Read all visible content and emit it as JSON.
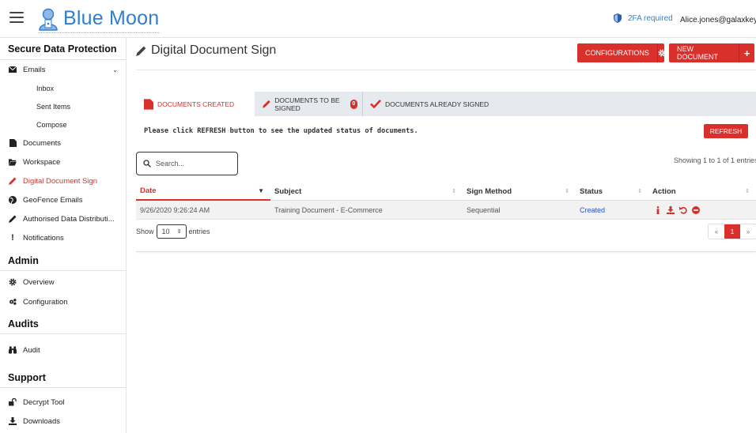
{
  "header": {
    "logo_text": "Blue Moon",
    "twofa_label": "2FA required",
    "user_email": "Alice.jones@galaxkey.io"
  },
  "sidebar": {
    "sections": [
      {
        "title": "Secure Data Protection"
      },
      {
        "title": "Admin"
      },
      {
        "title": "Audits"
      },
      {
        "title": "Support"
      }
    ],
    "emails_label": "Emails",
    "email_subitems": [
      "Inbox",
      "Sent Items",
      "Compose"
    ],
    "items_main": [
      {
        "label": "Documents",
        "icon": "file-icon"
      },
      {
        "label": "Workspace",
        "icon": "folder-open-icon"
      },
      {
        "label": "Digital Document Sign",
        "icon": "pencil-icon"
      },
      {
        "label": "GeoFence Emails",
        "icon": "globe-icon"
      },
      {
        "label": "Authorised Data Distributi...",
        "icon": "pencil-icon"
      },
      {
        "label": "Notifications",
        "icon": "exclamation-icon"
      }
    ],
    "admin_items": [
      {
        "label": "Overview",
        "icon": "gear-icon"
      },
      {
        "label": "Configuration",
        "icon": "gears-icon"
      }
    ],
    "audit_items": [
      {
        "label": "Audit",
        "icon": "binoculars-icon"
      }
    ],
    "support_items": [
      {
        "label": "Decrypt Tool",
        "icon": "unlock-icon"
      },
      {
        "label": "Downloads",
        "icon": "download-icon"
      }
    ]
  },
  "main": {
    "title": "Digital Document Sign",
    "configurations_label": "CONFIGURATIONS",
    "new_document_label": "NEW DOCUMENT",
    "tabs": [
      {
        "label": "DOCUMENTS CREATED"
      },
      {
        "label": "DOCUMENTS TO BE SIGNED",
        "badge": "0"
      },
      {
        "label": "DOCUMENTS ALREADY SIGNED"
      }
    ],
    "info_text": "Please click REFRESH button to see the updated status of documents.",
    "refresh_label": "REFRESH",
    "search_placeholder": "Search...",
    "showing_text": "Showing 1 to 1 of 1 entries",
    "columns": [
      "Date",
      "Subject",
      "Sign Method",
      "Status",
      "Action"
    ],
    "rows": [
      {
        "date": "9/26/2020 9:26:24 AM",
        "subject": "Training Document - E-Commerce",
        "sign_method": "Sequential",
        "status": "Created"
      }
    ],
    "show_label": "Show",
    "entries_label": "entries",
    "page_length": "10",
    "pager": {
      "prev": "«",
      "current": "1",
      "next": "»"
    }
  },
  "colors": {
    "accent": "#d9302b",
    "brand": "#2f7fd1",
    "link": "#2b54c9"
  }
}
